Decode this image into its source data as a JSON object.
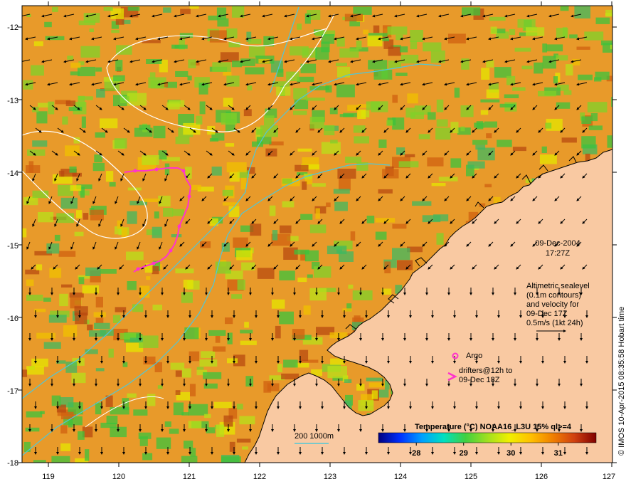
{
  "map": {
    "lon_ticks": [
      "119",
      "120",
      "121",
      "122",
      "123",
      "124",
      "125",
      "126",
      "127"
    ],
    "lat_ticks": [
      "-12",
      "-13",
      "-14",
      "-15",
      "-16",
      "-17",
      "-18"
    ],
    "lon_range": [
      118.6,
      127.0
    ],
    "lat_range": [
      -11.8,
      -18.0
    ]
  },
  "date": "09-Dec-2004",
  "time": "17:27Z",
  "info_lines": [
    "Altimetric sealevel",
    "(0.1m contours)",
    "and velocity for",
    "09-Dec 17Z",
    "0.5m/s (1kt 24h)"
  ],
  "argo_label": "Argo",
  "drifters_label_1": "drifters@12h to",
  "drifters_label_2": "09-Dec 18Z",
  "bathy_label": "200  1000m",
  "colorbar": {
    "title": "Temperature (°C) NOAA16_L3U 15% ql>=4",
    "ticks": [
      "28",
      "29",
      "30",
      "31"
    ],
    "range": [
      27.2,
      31.8
    ]
  },
  "credit": "© IMOS 10-Apr-2015 08:35:58 Hobart time",
  "colors": {
    "land": "#f9c9a2",
    "sst_dominant": "#e89a2a",
    "drifter": "#ff33cc",
    "bathymetry": "#4fc7d8"
  }
}
